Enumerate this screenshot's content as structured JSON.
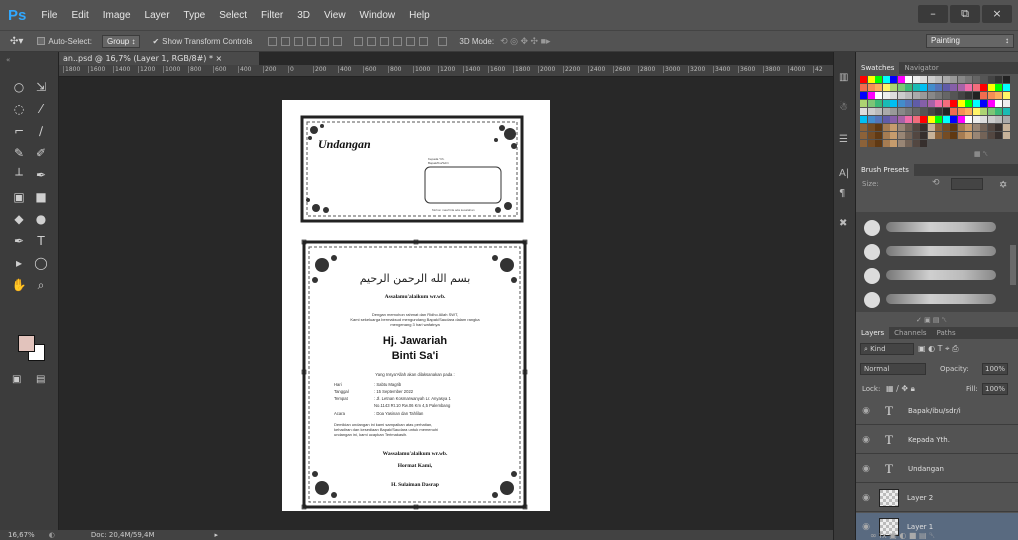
{
  "app": {
    "logo": "Ps"
  },
  "menu": [
    "File",
    "Edit",
    "Image",
    "Layer",
    "Type",
    "Select",
    "Filter",
    "3D",
    "View",
    "Window",
    "Help"
  ],
  "window_controls": [
    "–",
    "⧉",
    "×"
  ],
  "options_bar": {
    "auto_select": "Auto-Select:",
    "group": "Group",
    "show_transform": "Show Transform Controls",
    "mode_3d": "3D Mode:",
    "workspace": "Painting"
  },
  "doc_tab": "an..psd @ 16,7% (Layer 1, RGB/8#) *",
  "ruler_ticks": [
    "1800",
    "1600",
    "1400",
    "1200",
    "1000",
    "800",
    "600",
    "400",
    "200",
    "0",
    "200",
    "400",
    "600",
    "800",
    "1000",
    "1200",
    "1400",
    "1600",
    "1800",
    "2000",
    "2200",
    "2400",
    "2600",
    "2800",
    "3000",
    "3200",
    "3400",
    "3600",
    "3800",
    "4000",
    "42"
  ],
  "status": {
    "zoom": "16,67%",
    "doc": "Doc: 20,4M/59,4M"
  },
  "document": {
    "envelope_title": "Undangan",
    "envelope_to_small": "Kepada Yth.",
    "envelope_to_small2": "Bapak/Ibu/Sdr/i",
    "envelope_footer": "Mohon maaf bila ada kesalahan",
    "arabic": "بسم الله الرحمن الرحيم",
    "salam": "Assalamu'alaikum wr.wb.",
    "intro_line1": "Dengan memohon rahmat dan Ridho Allah SWT,",
    "intro_line2": "Kami sekeluarga bermaksud mengundang Bapak/Saudara dalam rangka",
    "intro_line3": "mengenang 3 hari wafatnya",
    "name1": "Hj. Jawariah",
    "name2": "Binti  Sa'i",
    "event_intro": "Yang Insya'Allah akan dilaksanakan pada :",
    "details": [
      {
        "label": "Hari",
        "value": ": Sabtu Magrib"
      },
      {
        "label": "Tanggal",
        "value": ": 15 September 2022"
      },
      {
        "label": "Tempat",
        "value": ": Jl. Letnan Kosmarwanyah Lr. Anyasya 1"
      },
      {
        "label": "",
        "value": "  No.1143 Rt.10 Rw.06 Km 4,5 Palembang"
      },
      {
        "label": "Acara",
        "value": ": Doa Yasinan dan Tahlilan"
      }
    ],
    "closing1": "Demikian undangan ini kami sampaikan atas perhatian,",
    "closing2": "kehadiran dan kesediaan Bapak/Saudara untuk memenuhi",
    "closing3": "undangan ini, kami ucapkan Terimakasih.",
    "wassalam": "Wassalamu'alaikum wr.wb.",
    "hormat": "Hormat Kami,",
    "signer": "H. Sulaiman Dasrap"
  },
  "panels": {
    "swatch_tabs": [
      "Swatches",
      "Navigator"
    ],
    "brush_title": "Brush Presets",
    "brush_size": "Size:",
    "layer_tabs": [
      "Layers",
      "Channels",
      "Paths"
    ],
    "kind": "⌕ Kind",
    "blend": "Normal",
    "opacity_label": "Opacity:",
    "opacity": "100%",
    "lock_label": "Lock:",
    "fill_label": "Fill:",
    "fill": "100%",
    "layers": [
      {
        "type": "text",
        "name": "Bapak/ibu/sdr/i"
      },
      {
        "type": "text",
        "name": "Kepada Yth."
      },
      {
        "type": "text",
        "name": "Undangan"
      },
      {
        "type": "image",
        "name": "Layer 2"
      },
      {
        "type": "image",
        "name": "Layer 1",
        "selected": true
      }
    ]
  },
  "colors": {
    "foreground": "#e2c3bc",
    "background": "#ffffff",
    "accent": "#31a8ff"
  }
}
